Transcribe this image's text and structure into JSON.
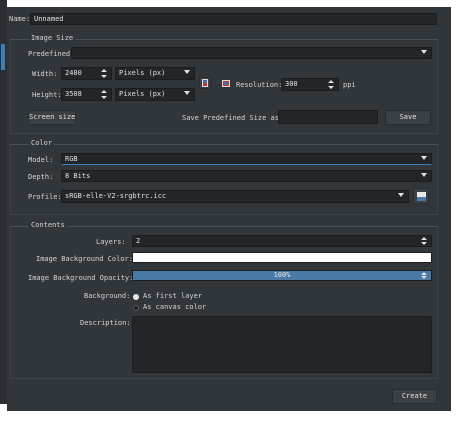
{
  "name": {
    "label": "Name:",
    "value": "Unnamed"
  },
  "image_size": {
    "title": "Image Size",
    "predefined_label": "Predefined:",
    "predefined_value": "",
    "width_label": "Width:",
    "width_value": "2480",
    "width_unit": "Pixels (px)",
    "height_label": "Height:",
    "height_value": "3508",
    "height_unit": "Pixels (px)",
    "resolution_label": "Resolution:",
    "resolution_value": "300",
    "resolution_unit": "ppi",
    "screen_size_button": "Screen size",
    "save_predefined_label": "Save Predefined Size as:",
    "save_predefined_value": "",
    "save_button": "Save"
  },
  "color": {
    "title": "Color",
    "model_label": "Model:",
    "model_value": "RGB",
    "depth_label": "Depth:",
    "depth_value": "8 Bits",
    "profile_label": "Profile:",
    "profile_value": "sRGB-elle-V2-srgbtrc.icc"
  },
  "contents": {
    "title": "Contents",
    "layers_label": "Layers:",
    "layers_value": "2",
    "bg_color_label": "Image Background Color:",
    "bg_color_value": "#ffffff",
    "bg_opacity_label": "Image Background Opacity:",
    "bg_opacity_value": "100%",
    "background_label": "Background:",
    "bg_option_1": "As first layer",
    "bg_option_2": "As canvas color",
    "description_label": "Description:",
    "description_value": ""
  },
  "footer": {
    "create_button": "Create"
  },
  "colors": {
    "dialog_bg": "#31363b",
    "field_bg": "#232629",
    "accent": "#3d7db8",
    "opacity_bar": "#4a7ba6"
  }
}
